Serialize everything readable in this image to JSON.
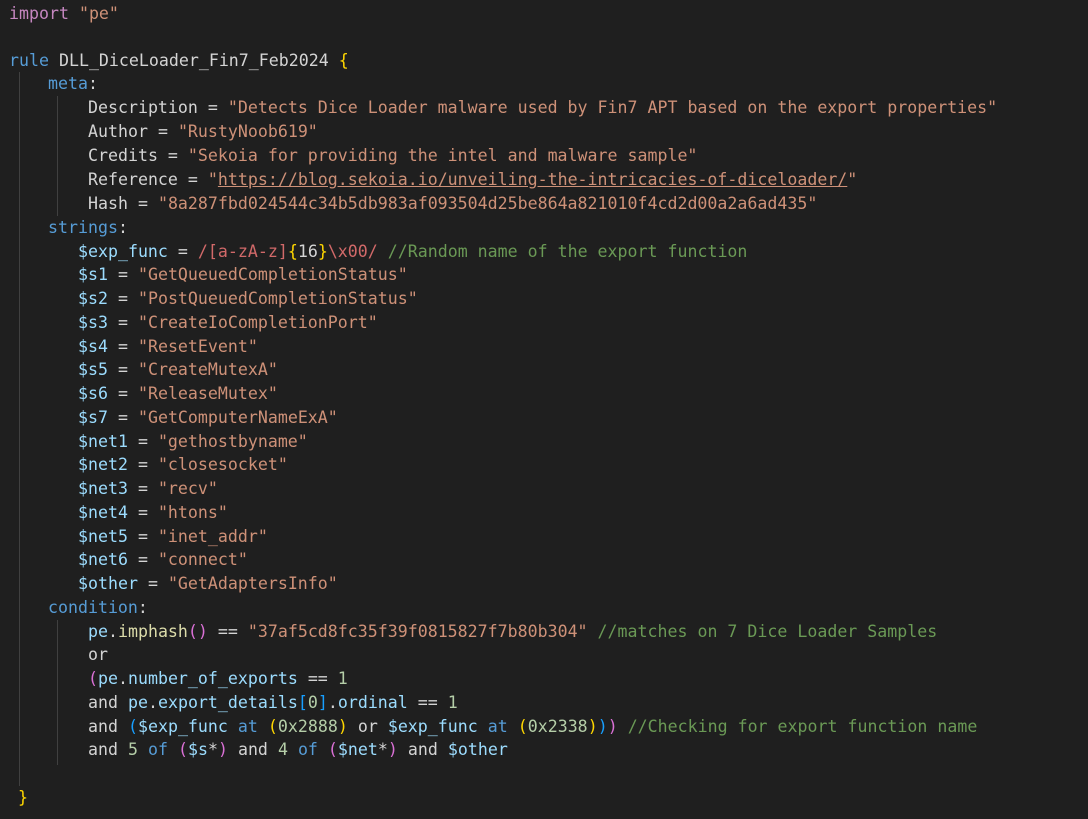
{
  "editor": {
    "import_keyword": "import",
    "import_module": "\"pe\"",
    "rule_keyword": "rule",
    "rule_name": "DLL_DiceLoader_Fin7_Feb2024",
    "open_brace": "{",
    "close_brace": "}",
    "meta_label": "meta",
    "strings_label": "strings",
    "condition_label": "condition",
    "colon": ":",
    "meta": [
      {
        "key": "Description",
        "value": "\"Detects Dice Loader malware used by Fin7 APT based on the export properties\""
      },
      {
        "key": "Author",
        "value": "\"RustyNoob619\""
      },
      {
        "key": "Credits",
        "value": "\"Sekoia for providing the intel and malware sample\""
      },
      {
        "key": "Reference",
        "value_prefix": "\"",
        "url": "https://blog.sekoia.io/unveiling-the-intricacies-of-diceloader/",
        "value_suffix": "\""
      },
      {
        "key": "Hash",
        "value": "\"8a287fbd024544c34b5db983af093504d25be864a821010f4cd2d00a2a6ad435\""
      }
    ],
    "exp_func": {
      "var": "$exp_func",
      "regex_open": "/[a-zA-z]",
      "brace_open": "{",
      "quant": "16",
      "brace_close": "}",
      "regex_close": "\\x00/",
      "comment": "//Random name of the export function"
    },
    "strings": [
      {
        "var": "$s1",
        "value": "\"GetQueuedCompletionStatus\""
      },
      {
        "var": "$s2",
        "value": "\"PostQueuedCompletionStatus\""
      },
      {
        "var": "$s3",
        "value": "\"CreateIoCompletionPort\""
      },
      {
        "var": "$s4",
        "value": "\"ResetEvent\""
      },
      {
        "var": "$s5",
        "value": "\"CreateMutexA\""
      },
      {
        "var": "$s6",
        "value": "\"ReleaseMutex\""
      },
      {
        "var": "$s7",
        "value": "\"GetComputerNameExA\""
      },
      {
        "var": "$net1",
        "value": "\"gethostbyname\""
      },
      {
        "var": "$net2",
        "value": "\"closesocket\""
      },
      {
        "var": "$net3",
        "value": "\"recv\""
      },
      {
        "var": "$net4",
        "value": "\"htons\""
      },
      {
        "var": "$net5",
        "value": "\"inet_addr\""
      },
      {
        "var": "$net6",
        "value": "\"connect\""
      },
      {
        "var": "$other",
        "value": "\"GetAdaptersInfo\""
      }
    ],
    "condition": {
      "pe": "pe",
      "imphash": "imphash",
      "imphash_value": "\"37af5cd8fc35f39f0815827f7b80b304\"",
      "imphash_comment": "//matches on 7 Dice Loader Samples",
      "or": "or",
      "number_of_exports": "number_of_exports",
      "one": "1",
      "and": "and",
      "export_details": "export_details",
      "zero": "0",
      "ordinal": "ordinal",
      "exp_func": "$exp_func",
      "at": "at",
      "addr1": "0x2888",
      "addr2": "0x2338",
      "export_comment": "//Checking for export function name",
      "five": "5",
      "of": "of",
      "s_wild": "$s",
      "four": "4",
      "net_wild": "$net",
      "other": "$other"
    }
  }
}
